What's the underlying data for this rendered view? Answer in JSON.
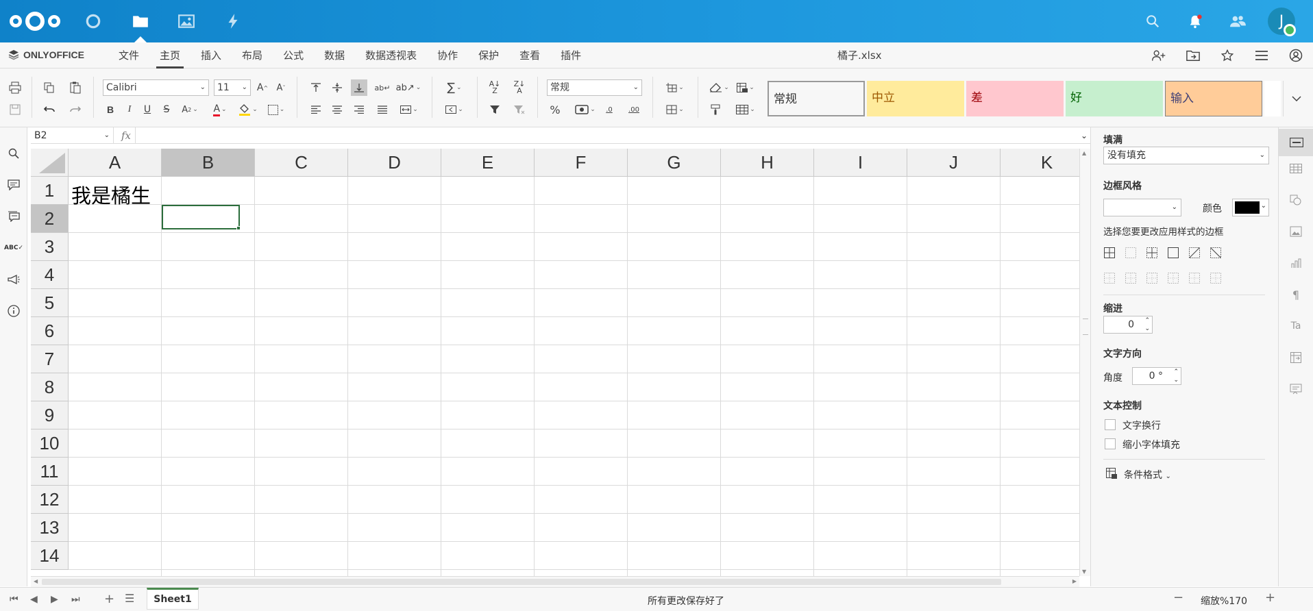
{
  "nextcloud": {
    "apps": [
      "dashboard-icon",
      "files-icon",
      "photos-icon",
      "activity-icon"
    ],
    "active_app": "files-icon",
    "avatar_letter": "J",
    "status_color": "#46ba61",
    "brand_color": "#0082c9"
  },
  "menu": {
    "brand": "ONLYOFFICE",
    "tabs": [
      "文件",
      "主页",
      "插入",
      "布局",
      "公式",
      "数据",
      "数据透视表",
      "协作",
      "保护",
      "查看",
      "插件"
    ],
    "active_tab": "主页",
    "doc_title": "橘子.xlsx"
  },
  "toolbar": {
    "font_name": "Calibri",
    "font_size": "11",
    "number_format": "常规",
    "cell_styles": [
      {
        "label": "常规",
        "bg": "#ffffff",
        "fg": "#000000"
      },
      {
        "label": "中立",
        "bg": "#ffeb9c",
        "fg": "#9c5700"
      },
      {
        "label": "差",
        "bg": "#ffc7ce",
        "fg": "#9c0006"
      },
      {
        "label": "好",
        "bg": "#c6efce",
        "fg": "#006100"
      },
      {
        "label": "输入",
        "bg": "#ffcc99",
        "fg": "#3f3f76"
      }
    ],
    "percent": "%",
    "dec_dec": ".0",
    "dec_inc": ".00"
  },
  "formula": {
    "name_box": "B2",
    "fx": "fx",
    "content": ""
  },
  "grid": {
    "columns": [
      "A",
      "B",
      "C",
      "D",
      "E",
      "F",
      "G",
      "H",
      "I",
      "J",
      "K"
    ],
    "rows": [
      "1",
      "2",
      "3",
      "4",
      "5",
      "6",
      "7",
      "8",
      "9",
      "10",
      "11",
      "12",
      "13",
      "14"
    ],
    "selected_column": "B",
    "selected_row": "2",
    "cells": {
      "A1": "我是橘生"
    }
  },
  "right_panel": {
    "fill_label": "填满",
    "fill_value": "没有填充",
    "border_style_label": "边框风格",
    "color_label": "颜色",
    "border_color": "#000000",
    "border_hint": "选择您要更改应用样式的边框",
    "indent_label": "缩进",
    "indent_value": "0",
    "text_direction_label": "文字方向",
    "angle_label": "角度",
    "angle_value": "0 °",
    "text_control_label": "文本控制",
    "wrap_label": "文字换行",
    "shrink_label": "缩小字体填充",
    "cond_format_label": "条件格式"
  },
  "status": {
    "sheet_name": "Sheet1",
    "save_message": "所有更改保存好了",
    "zoom_label": "缩放%170"
  }
}
